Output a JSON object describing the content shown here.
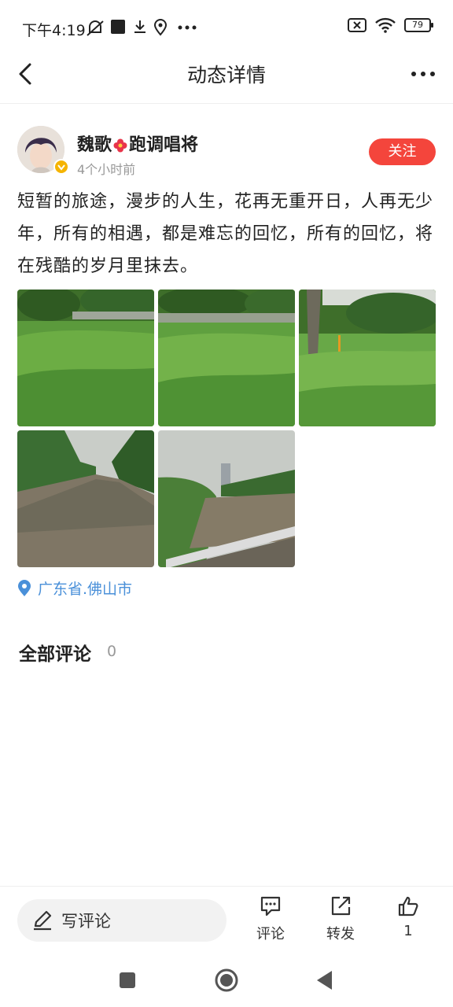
{
  "status_bar": {
    "time": "下午4:19",
    "battery": "79",
    "icons": [
      "mute-icon",
      "app-icon",
      "download-icon",
      "location-icon",
      "more-dots-icon",
      "no-sim-icon",
      "wifi-icon",
      "battery-icon"
    ]
  },
  "header": {
    "title": "动态详情",
    "back_icon": "back-arrow-icon",
    "more_icon": "more-horizontal-icon"
  },
  "post": {
    "user_name_part1": "魏歌",
    "user_name_part2": "跑调唱将",
    "time_ago": "4个小时前",
    "follow_label": "关注",
    "content": "短暂的旅途，漫步的人生，花再无重开日，人再无少年，所有的相遇，都是难忘的回忆，所有的回忆，将在残酷的岁月里抹去。",
    "photos": [
      "grass-photo-1",
      "grass-photo-2",
      "grass-photo-3",
      "river-photo-1",
      "river-photo-2"
    ],
    "location": "广东省.佛山市"
  },
  "comments": {
    "title": "全部评论",
    "count": "0"
  },
  "bottom_bar": {
    "input_placeholder": "写评论",
    "comment_label": "评论",
    "share_label": "转发",
    "like_count": "1"
  },
  "colors": {
    "accent_red": "#f4453c",
    "location_blue": "#4a90d9"
  }
}
